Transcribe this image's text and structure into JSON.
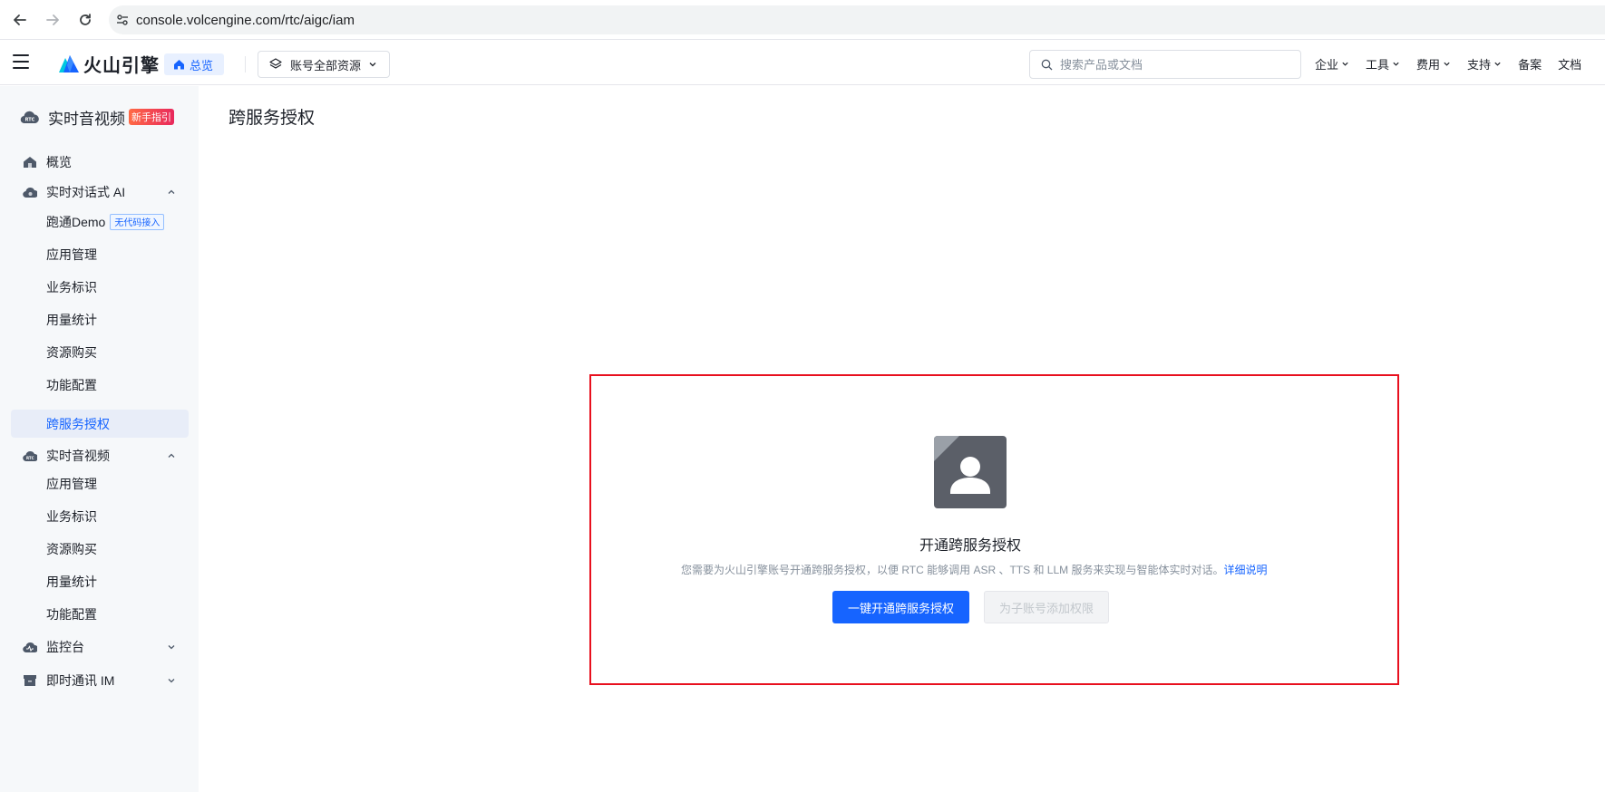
{
  "browser": {
    "url": "console.volcengine.com/rtc/aigc/iam"
  },
  "header": {
    "brand": "火山引擎",
    "overview_label": "总览",
    "resource_select": "账号全部资源",
    "search_placeholder": "搜索产品或文档",
    "menu": [
      {
        "label": "企业",
        "has_dropdown": true
      },
      {
        "label": "工具",
        "has_dropdown": true
      },
      {
        "label": "费用",
        "has_dropdown": true
      },
      {
        "label": "支持",
        "has_dropdown": true
      },
      {
        "label": "备案",
        "has_dropdown": false
      },
      {
        "label": "文档",
        "has_dropdown": false
      }
    ]
  },
  "sidebar": {
    "title": "实时音视频",
    "title_badge": "新手指引",
    "items": [
      {
        "label": "概览"
      },
      {
        "label": "实时对话式 AI",
        "expanded": true
      },
      {
        "label": "跑通Demo",
        "tag": "无代码接入"
      },
      {
        "label": "应用管理"
      },
      {
        "label": "业务标识"
      },
      {
        "label": "用量统计"
      },
      {
        "label": "资源购买"
      },
      {
        "label": "功能配置"
      },
      {
        "label": "跨服务授权",
        "active": true
      },
      {
        "label": "实时音视频",
        "expanded": true
      },
      {
        "label": "应用管理"
      },
      {
        "label": "业务标识"
      },
      {
        "label": "资源购买"
      },
      {
        "label": "用量统计"
      },
      {
        "label": "功能配置"
      },
      {
        "label": "监控台",
        "expanded": false
      },
      {
        "label": "即时通讯 IM",
        "expanded": false
      }
    ]
  },
  "main": {
    "page_title": "跨服务授权",
    "empty_title": "开通跨服务授权",
    "empty_desc": "您需要为火山引擎账号开通跨服务授权，以便 RTC 能够调用 ASR 、TTS 和 LLM 服务来实现与智能体实时对话。",
    "detail_link": "详细说明",
    "primary_button": "一键开通跨服务授权",
    "secondary_button": "为子账号添加权限"
  },
  "colors": {
    "accent": "#1664ff",
    "highlight_border": "#e8101e",
    "sidebar_bg": "#f6f8fa"
  }
}
